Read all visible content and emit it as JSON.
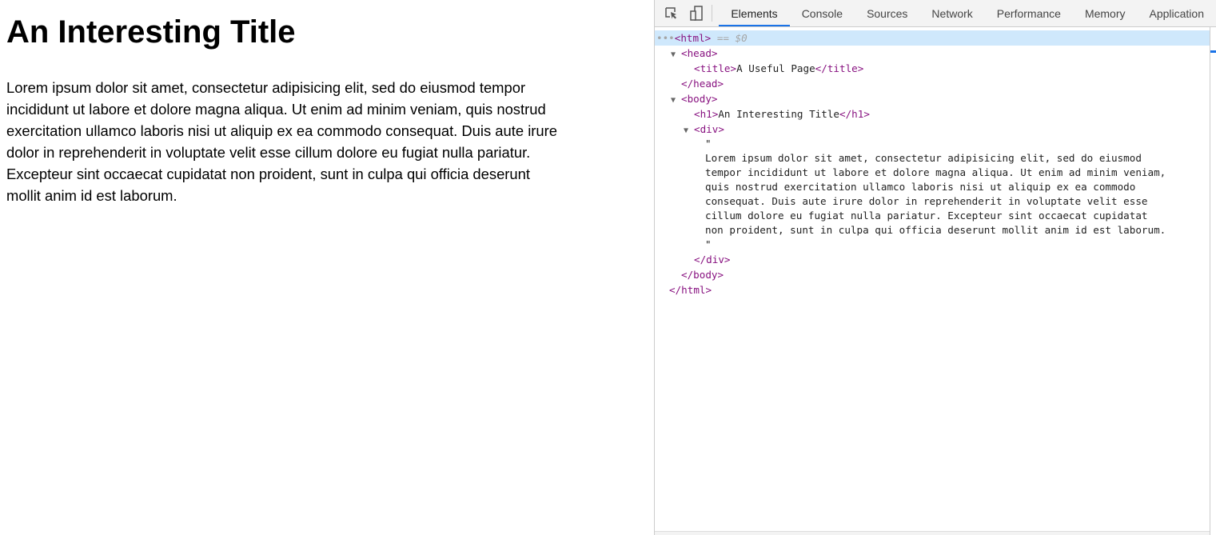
{
  "page": {
    "title": "An Interesting Title",
    "paragraph_lines": [
      "Lorem ipsum dolor sit amet, consectetur adipisicing elit, sed do eiusmod tempor",
      "incididunt ut labore et dolore magna aliqua. Ut enim ad minim veniam, quis nostrud",
      "exercitation ullamco laboris nisi ut aliquip ex ea commodo consequat. Duis aute irure",
      "dolor in reprehenderit in voluptate velit esse cillum dolore eu fugiat nulla pariatur.",
      "Excepteur sint occaecat cupidatat non proident, sunt in culpa qui officia deserunt",
      "mollit anim id est laborum."
    ]
  },
  "devtools": {
    "tabs": [
      "Elements",
      "Console",
      "Sources",
      "Network",
      "Performance",
      "Memory",
      "Application"
    ],
    "active_tab": "Elements",
    "icons": [
      "inspect-element-icon",
      "device-toolbar-icon"
    ],
    "tree": {
      "html_open": "<html>",
      "selected_marker": " == $0",
      "ellipsis": "•••",
      "head_open": "<head>",
      "title_open": "<title>",
      "title_text": "A Useful Page",
      "title_close": "</title>",
      "head_close": "</head>",
      "body_open": "<body>",
      "h1_open": "<h1>",
      "h1_text": "An Interesting Title",
      "h1_close": "</h1>",
      "div_open": "<div>",
      "quote": "\"",
      "text_lines": [
        "Lorem ipsum dolor sit amet, consectetur adipisicing elit, sed do eiusmod",
        "tempor incididunt ut labore et dolore magna aliqua. Ut enim ad minim veniam,",
        "quis nostrud exercitation ullamco laboris nisi ut aliquip ex ea commodo",
        "consequat. Duis aute irure dolor in reprehenderit in voluptate velit esse",
        "cillum dolore eu fugiat nulla pariatur. Excepteur sint occaecat cupidatat",
        "non proident, sunt in culpa qui officia deserunt mollit anim id est laborum."
      ],
      "div_close": "</div>",
      "body_close": "</body>",
      "html_close": "</html>"
    },
    "colors": {
      "tag": "#881280",
      "selected_row": "#cfe8fc",
      "accent": "#1a73e8"
    }
  }
}
